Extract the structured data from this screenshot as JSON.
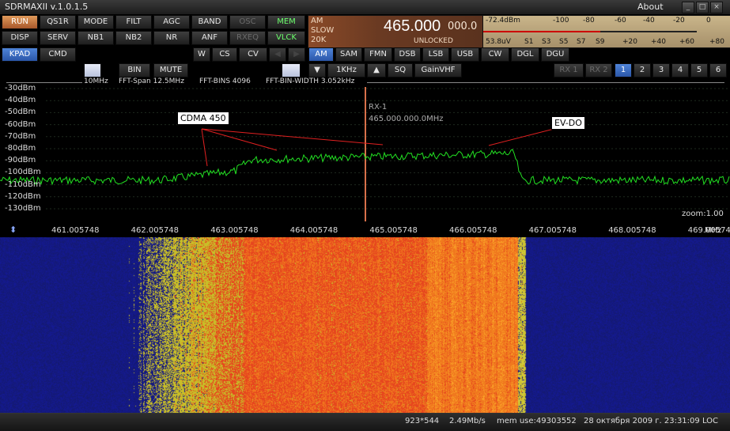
{
  "window": {
    "title": "SDRMAXII v.1.0.1.5",
    "about": "About"
  },
  "buttons_row1": [
    "RUN",
    "QS1R",
    "MODE",
    "FILT",
    "AGC",
    "BAND",
    "OSC",
    "MEM"
  ],
  "buttons_row2": [
    "DISP",
    "SERV",
    "NB1",
    "NB2",
    "NR",
    "ANF",
    "RXEQ",
    "VLCK"
  ],
  "buttons_row3": [
    "KPAD",
    "CMD",
    "W",
    "CS",
    "CV"
  ],
  "row4": {
    "bin": "BIN",
    "mute": "MUTE",
    "step": "1KHz",
    "sq": "SQ",
    "gain": "GainVHF",
    "rx1": "RX 1",
    "rx2": "RX 2",
    "pages": [
      "1",
      "2",
      "3",
      "4",
      "5",
      "6"
    ]
  },
  "freq": {
    "agc_mode": "AM",
    "agc_speed": "SLOW",
    "bw": "20K",
    "main": "465.000",
    "sub": "000.0",
    "lock": "UNLOCKED"
  },
  "meter": {
    "dbm": "-72.4dBm",
    "uv": "53.8uV",
    "top_scale": [
      "-100",
      "-80",
      "-60",
      "-40",
      "-20",
      "0"
    ],
    "bottom_scale": [
      "S1",
      "S3",
      "S5",
      "S7",
      "S9",
      "+20",
      "+40",
      "+60",
      "+80"
    ]
  },
  "modes": [
    "AM",
    "SAM",
    "FMN",
    "DSB",
    "LSB",
    "USB",
    "CW",
    "DGL",
    "DGU"
  ],
  "info": {
    "left": "10MHz",
    "span": "FFT-Span 12.5MHz",
    "bins": "FFT-BINS 4096",
    "binwidth": "FFT-BIN-WIDTH 3.052kHz"
  },
  "spectrum": {
    "db_labels": [
      "-30dBm",
      "-40dBm",
      "-50dBm",
      "-60dBm",
      "-70dBm",
      "-80dBm",
      "-90dBm",
      "-100dBm",
      "-110dBm",
      "-120dBm",
      "-130dBm"
    ],
    "rx_label": "RX-1",
    "rx_freq": "465.000.000.0MHz",
    "callout1": "CDMA 450",
    "callout2": "EV-DO",
    "zoom": "zoom:1.00"
  },
  "freq_axis": [
    "461.005748",
    "462.005748",
    "463.005748",
    "464.005748",
    "465.005748",
    "466.005748",
    "467.005748",
    "468.005748",
    "469.005748"
  ],
  "freq_unit": "MHz",
  "status": {
    "res": "923*544",
    "rate": "2.49Mb/s",
    "mem": "mem use:49303552",
    "date": "28 октября 2009 г. 23:31:09 LOC"
  }
}
